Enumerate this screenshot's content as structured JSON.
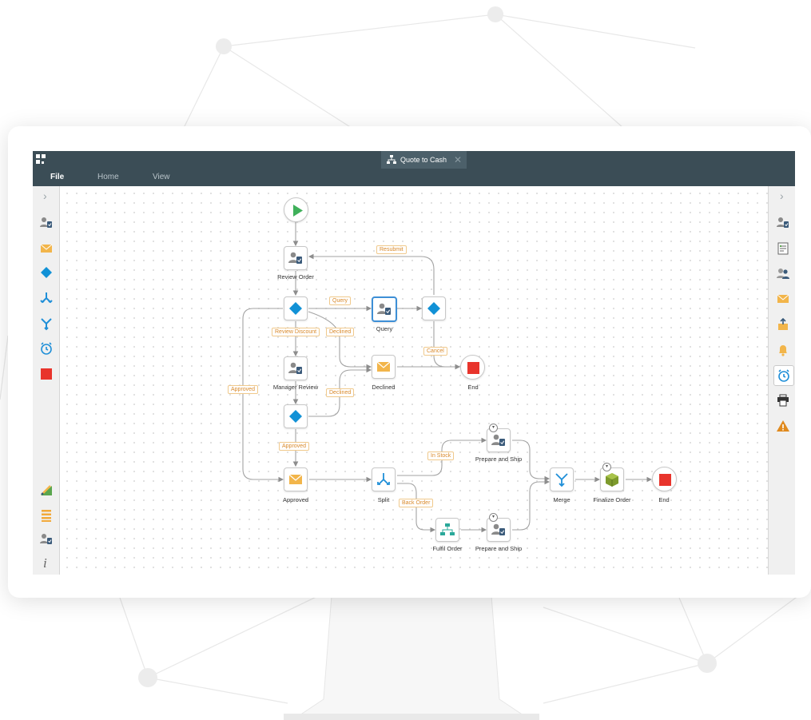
{
  "window": {
    "tab_title": "Quote to Cash",
    "tab_close": "✕"
  },
  "menu": {
    "file": "File",
    "home": "Home",
    "view": "View"
  },
  "panels": {
    "left_chevron": "›",
    "right_chevron": "›",
    "info": "i"
  },
  "left_tools": [
    "user-task-icon",
    "email-icon",
    "decision-icon",
    "split-icon",
    "merge-icon",
    "timer-icon",
    "end-icon",
    "paint-icon",
    "list-icon",
    "user-task-icon",
    "info-icon"
  ],
  "right_tools": [
    "user-task-icon",
    "form-icon",
    "users-icon",
    "email-icon",
    "upload-icon",
    "bell-icon",
    "timer-icon",
    "print-icon",
    "warning-icon"
  ],
  "colors": {
    "titlebar": "#3b4d56",
    "start_green": "#3fb05a",
    "decision_blue": "#1191d6",
    "email_orange": "#f2b54a",
    "end_red": "#e8342c",
    "split_blue": "#1f8fd8",
    "edge_label": "#d9892a",
    "selected_border": "#3d8fd6"
  },
  "nodes": {
    "review_order": "Review Order",
    "query": "Query",
    "manager_review": "Manager Review",
    "declined": "Declined",
    "end_top": "End",
    "approved": "Approved",
    "split": "Split",
    "prepare_ship_top": "Prepare and Ship",
    "fulfil_order": "Fulfil Order",
    "prepare_ship_bottom": "Prepare and Ship",
    "merge": "Merge",
    "finalize_order": "Finalize Order",
    "end_bottom": "End"
  },
  "edges": {
    "resubmit": "Resubmit",
    "query": "Query",
    "review_discount": "Review Discount",
    "declined_1": "Declined",
    "cancel": "Cancel",
    "approved_side": "Approved",
    "declined_2": "Declined",
    "approved_2": "Approved",
    "in_stock": "In Stock",
    "back_order": "Back Order"
  }
}
